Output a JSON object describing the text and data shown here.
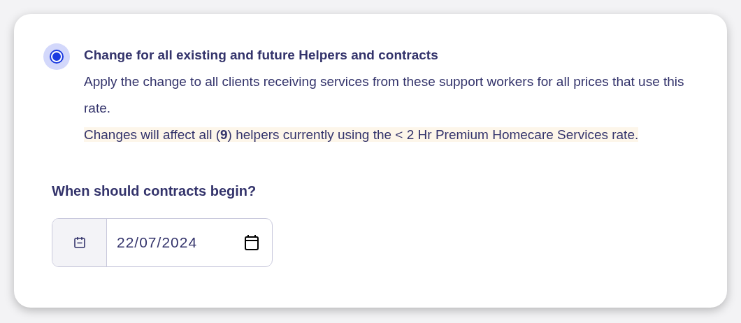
{
  "option": {
    "selected": true,
    "title": "Change for all existing and future Helpers and contracts",
    "description": "Apply the change to all clients receiving services from these support workers for all prices that use this rate.",
    "notice": "Changes will affect all (**9**) helpers currently using the < 2 Hr Premium Homecare Services rate."
  },
  "start_date": {
    "label": "When should contracts begin?",
    "value": "22/07/2024"
  }
}
